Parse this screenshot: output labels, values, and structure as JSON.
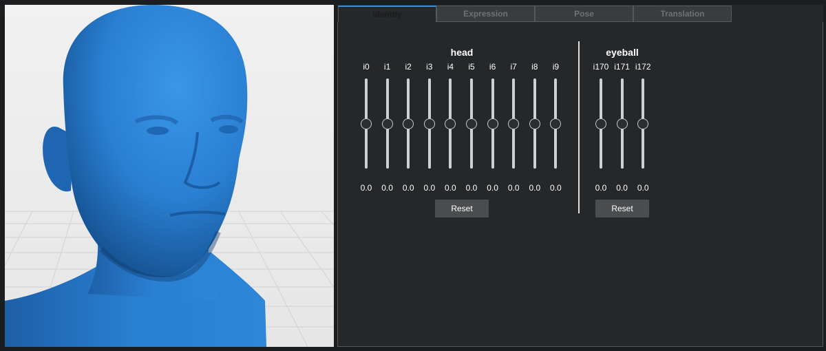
{
  "tabs": [
    {
      "label": "Identity",
      "active": true
    },
    {
      "label": "Expression",
      "active": false
    },
    {
      "label": "Pose",
      "active": false
    },
    {
      "label": "Translation",
      "active": false
    }
  ],
  "groups": {
    "head": {
      "title": "head",
      "sliders": [
        {
          "label": "i0",
          "value": "0.0",
          "level": 0.5
        },
        {
          "label": "i1",
          "value": "0.0",
          "level": 0.5
        },
        {
          "label": "i2",
          "value": "0.0",
          "level": 0.5
        },
        {
          "label": "i3",
          "value": "0.0",
          "level": 0.5
        },
        {
          "label": "i4",
          "value": "0.0",
          "level": 0.5
        },
        {
          "label": "i5",
          "value": "0.0",
          "level": 0.5
        },
        {
          "label": "i6",
          "value": "0.0",
          "level": 0.5
        },
        {
          "label": "i7",
          "value": "0.0",
          "level": 0.5
        },
        {
          "label": "i8",
          "value": "0.0",
          "level": 0.5
        },
        {
          "label": "i9",
          "value": "0.0",
          "level": 0.5
        }
      ],
      "reset_label": "Reset"
    },
    "eyeball": {
      "title": "eyeball",
      "sliders": [
        {
          "label": "i170",
          "value": "0.0",
          "level": 0.5
        },
        {
          "label": "i171",
          "value": "0.0",
          "level": 0.5
        },
        {
          "label": "i172",
          "value": "0.0",
          "level": 0.5
        }
      ],
      "reset_label": "Reset"
    }
  },
  "colors": {
    "model": "#2f86d6",
    "panel_bg": "#252729",
    "active_tab_accent": "#3d8fd6"
  }
}
